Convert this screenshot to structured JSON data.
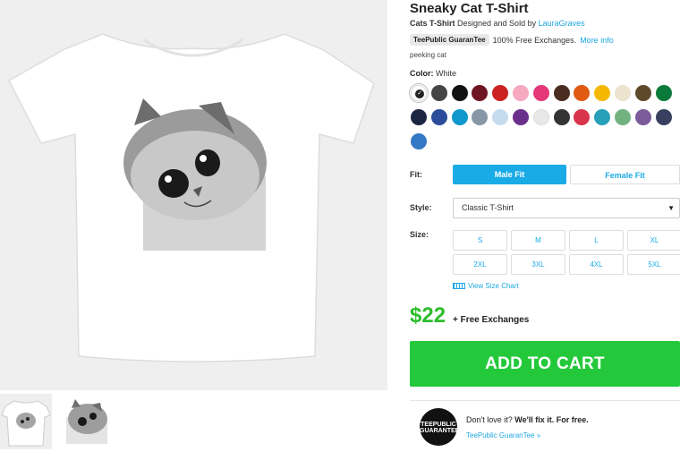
{
  "product": {
    "title": "Sneaky Cat T-Shirt",
    "byline_product": "Cats T-Shirt",
    "byline_mid": " Designed and Sold by ",
    "designer": "LauraGraves",
    "guarantee_pill": "TeePublic GuaranTee",
    "exchanges_text": "100% Free Exchanges.",
    "more_info": "More info",
    "tag": "peeking cat"
  },
  "color": {
    "label": "Color:",
    "selected": "White",
    "swatches": [
      "#ffffff",
      "#444444",
      "#111111",
      "#6e1423",
      "#cc2222",
      "#f6a9c0",
      "#e5387a",
      "#4a2c20",
      "#e05a12",
      "#f5b800",
      "#ece3cf",
      "#5e4a2a",
      "#0a7a3b",
      "#1c2640",
      "#2a4c9a",
      "#0f98cc",
      "#8797a5",
      "#c5dcef",
      "#6a2f8a",
      "#e8e8e8",
      "#333333",
      "#d8344c",
      "#27a0b8",
      "#72b280",
      "#7b5b9a",
      "#384060",
      "#3378c4"
    ]
  },
  "fit": {
    "label": "Fit:",
    "options": [
      "Male Fit",
      "Female Fit"
    ],
    "selected": "Male Fit"
  },
  "style": {
    "label": "Style:",
    "value": "Classic T-Shirt",
    "caret": "▼"
  },
  "size": {
    "label": "Size:",
    "options": [
      "S",
      "M",
      "L",
      "XL",
      "2XL",
      "3XL",
      "4XL",
      "5XL"
    ],
    "chart_link": "View Size Chart"
  },
  "price": {
    "amount": "$22",
    "note": "+ Free Exchanges"
  },
  "cart": {
    "label": "ADD TO CART"
  },
  "guarantee": {
    "seal_text_1": "TEEPUBLIC",
    "seal_text_2": "GUARANTEE",
    "line1_a": "Don't love it? ",
    "line1_b": "We'll fix it. For free.",
    "link": "TeePublic GuaranTee »"
  }
}
